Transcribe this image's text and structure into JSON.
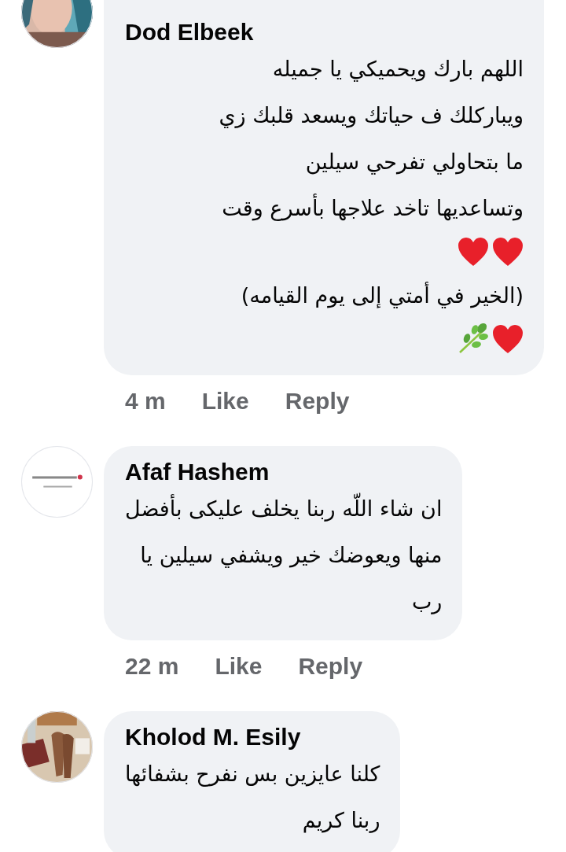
{
  "comments": [
    {
      "author": "Dod Elbeek",
      "avatar": {
        "kind": "picture"
      },
      "body": [
        {
          "kind": "text",
          "text": "اللهم بارك ويحميكي يا جميله"
        },
        {
          "kind": "text",
          "text": "ويباركلك ف حياتك ويسعد قلبك زي"
        },
        {
          "kind": "text",
          "text": "ما بتحاولي تفرحي سيلين"
        },
        {
          "kind": "text",
          "text": "وتساعديها تاخد علاجها بأسرع وقت"
        },
        {
          "kind": "icons",
          "icons": [
            {
              "kind": "heart"
            },
            {
              "kind": "heart"
            }
          ]
        },
        {
          "kind": "text",
          "text": "(الخير في أمتي إلى يوم القيامه)"
        },
        {
          "kind": "icons",
          "icons": [
            {
              "kind": "heart"
            },
            {
              "kind": "herb"
            }
          ]
        }
      ],
      "time": "4 m",
      "like": "Like",
      "reply": "Reply"
    },
    {
      "author": "Afaf Hashem",
      "avatar": {
        "kind": "picture"
      },
      "body": [
        {
          "kind": "text",
          "text": "ان شاء اللّه ربنا يخلف عليكى بأفضل"
        },
        {
          "kind": "text",
          "text": "منها ويعوضك خير ويشفي سيلين يا"
        },
        {
          "kind": "text",
          "text": "رب"
        }
      ],
      "time": "22 m",
      "like": "Like",
      "reply": "Reply"
    },
    {
      "author": "Kholod M. Esily",
      "avatar": {
        "kind": "picture"
      },
      "body": [
        {
          "kind": "text",
          "text": "كلنا عايزين بس نفرح بشفائها"
        },
        {
          "kind": "text",
          "text": "ربنا كريم"
        }
      ]
    }
  ]
}
